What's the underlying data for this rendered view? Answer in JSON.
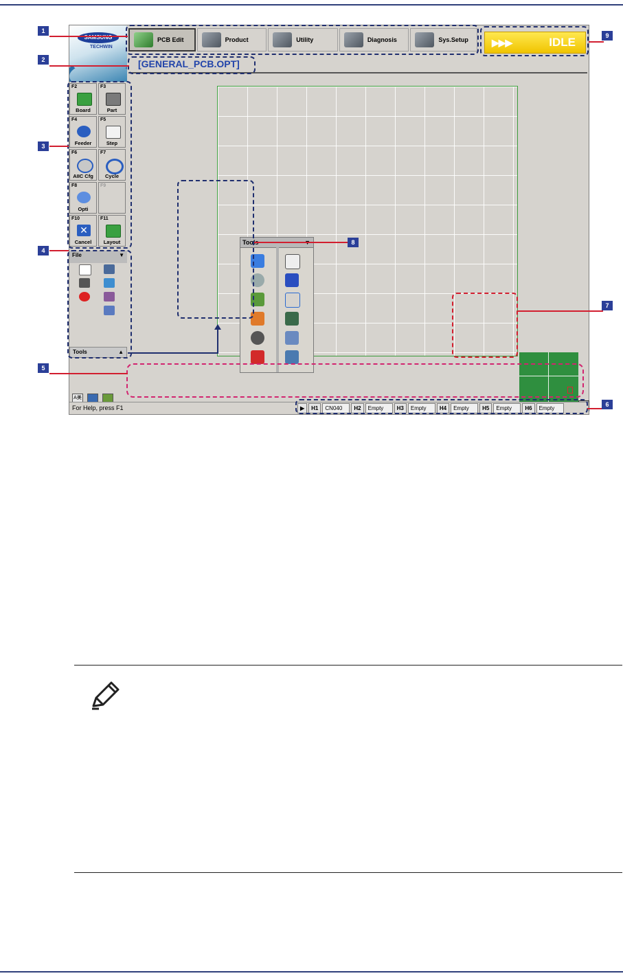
{
  "app": {
    "logo": "SAMSUNG",
    "logo_sub": "TECHWIN",
    "top_menu": [
      {
        "label": "PCB Edit",
        "icon": "pcb-edit-icon",
        "active": true
      },
      {
        "label": "Product",
        "icon": "product-icon",
        "active": false
      },
      {
        "label": "Utility",
        "icon": "utility-icon",
        "active": false
      },
      {
        "label": "Diagnosis",
        "icon": "diagnosis-icon",
        "active": false
      },
      {
        "label": "Sys.Setup",
        "icon": "sys-setup-icon",
        "active": false
      }
    ],
    "status_indicator": {
      "arrows": "▶▶▶",
      "label": "IDLE",
      "color": "#f5cc00"
    },
    "filename": "[GENERAL_PCB.OPT]",
    "function_keys": [
      {
        "key": "F2",
        "label": "Board",
        "icon": "board-icon"
      },
      {
        "key": "F3",
        "label": "Part",
        "icon": "part-icon"
      },
      {
        "key": "F4",
        "label": "Feeder",
        "icon": "feeder-icon"
      },
      {
        "key": "F5",
        "label": "Step",
        "icon": "step-icon"
      },
      {
        "key": "F6",
        "label": "AIIC Cfg",
        "icon": "aiic-cfg-icon"
      },
      {
        "key": "F7",
        "label": "Cycle",
        "icon": "cycle-icon"
      },
      {
        "key": "F8",
        "label": "Opti",
        "icon": "opti-icon"
      },
      {
        "key": "F9",
        "label": "",
        "icon": "disabled"
      },
      {
        "key": "F10",
        "label": "Cancel",
        "icon": "cancel-icon"
      },
      {
        "key": "F11",
        "label": "Layout",
        "icon": "layout-icon"
      }
    ],
    "file_panel": {
      "title": "File",
      "arrow": "▼"
    },
    "tools_bar": {
      "label": "Tools",
      "arrow": "▲"
    },
    "tools_popup": {
      "title": "Tools",
      "arrow": "▼"
    },
    "status_help": "For Help, press F1",
    "play_symbol": "▶",
    "heads": [
      {
        "head": "H1",
        "value": "CN040"
      },
      {
        "head": "H2",
        "value": "Empty"
      },
      {
        "head": "H3",
        "value": "Empty"
      },
      {
        "head": "H4",
        "value": "Empty"
      },
      {
        "head": "H5",
        "value": "Empty"
      },
      {
        "head": "H6",
        "value": "Empty"
      }
    ],
    "tray_text": "A美"
  },
  "callouts": [
    "1",
    "2",
    "3",
    "4",
    "5",
    "6",
    "7",
    "8",
    "9"
  ],
  "colors": {
    "callout_bg": "#2b3f98",
    "leader": "#d21e2f",
    "pcb_green": "#2f8f3f",
    "filename": "#2244aa"
  }
}
